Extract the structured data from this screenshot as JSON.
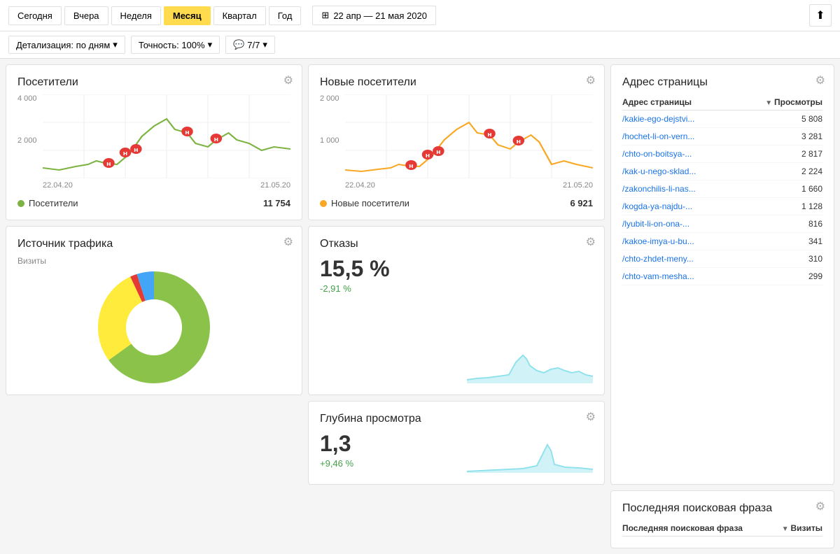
{
  "topbar": {
    "periods": [
      "Сегодня",
      "Вчера",
      "Неделя",
      "Месяц",
      "Квартал",
      "Год"
    ],
    "active_period": "Месяц",
    "date_range": "22 апр — 21 мая 2020",
    "grid_icon": "⊞"
  },
  "filterbar": {
    "detail_label": "Детализация: по дням",
    "accuracy_label": "Точность: 100%",
    "segments_label": "7/7"
  },
  "visitors": {
    "title": "Посетители",
    "legend": "Посетители",
    "value": "11 754",
    "y_labels": [
      "4 000",
      "2 000",
      ""
    ],
    "x_labels": [
      "22.04.20",
      "21.05.20"
    ],
    "color": "#7cb342"
  },
  "new_visitors": {
    "title": "Новые посетители",
    "legend": "Новые посетители",
    "value": "6 921",
    "y_labels": [
      "2 000",
      "1 000",
      ""
    ],
    "x_labels": [
      "22.04.20",
      "21.05.20"
    ],
    "color": "#f9a825"
  },
  "page_address": {
    "title": "Адрес страницы",
    "col1": "Адрес страницы",
    "col2": "Просмотры",
    "rows": [
      {
        "url": "/kakie-ego-dejstvi...",
        "views": "5 808"
      },
      {
        "url": "/hochet-li-on-vern...",
        "views": "3 281"
      },
      {
        "url": "/chto-on-boitsya-...",
        "views": "2 817"
      },
      {
        "url": "/kak-u-nego-sklad...",
        "views": "2 224"
      },
      {
        "url": "/zakonchilis-li-nas...",
        "views": "1 660"
      },
      {
        "url": "/kogda-ya-najdu-...",
        "views": "1 128"
      },
      {
        "url": "/lyubit-li-on-ona-...",
        "views": "816"
      },
      {
        "url": "/kakoe-imya-u-bu...",
        "views": "341"
      },
      {
        "url": "/chto-zhdet-meny...",
        "views": "310"
      },
      {
        "url": "/chto-vam-mesha...",
        "views": "299"
      }
    ]
  },
  "traffic_source": {
    "title": "Источник трафика",
    "subtitle": "Визиты",
    "segments": [
      {
        "color": "#8bc34a",
        "pct": 65
      },
      {
        "color": "#ffeb3b",
        "pct": 28
      },
      {
        "color": "#e53935",
        "pct": 2
      },
      {
        "color": "#42a5f5",
        "pct": 5
      }
    ]
  },
  "bounce": {
    "title": "Отказы",
    "value": "15,5 %",
    "change": "-2,91 %"
  },
  "depth": {
    "title": "Глубина просмотра",
    "value": "1,3",
    "change": "+9,46 %"
  },
  "last_search": {
    "title": "Последняя поисковая фраза",
    "col1": "Последняя поисковая фраза",
    "col2": "Визиты"
  }
}
